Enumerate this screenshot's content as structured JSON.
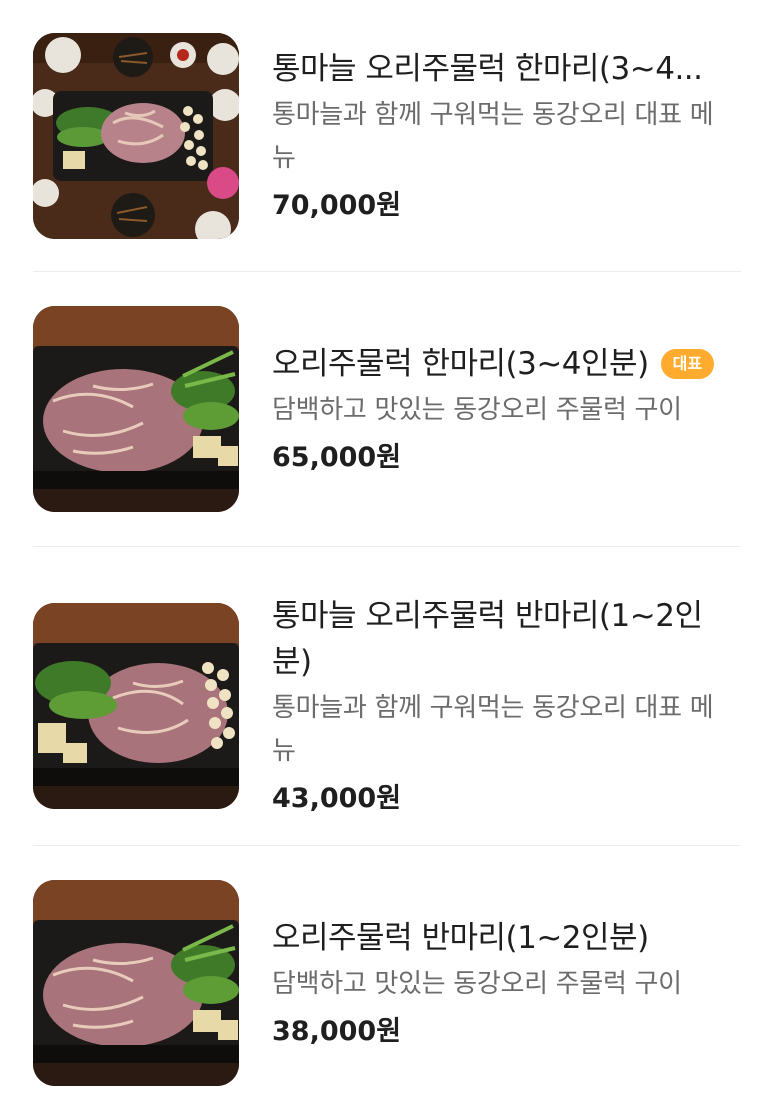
{
  "items": [
    {
      "title": "통마늘 오리주물럭 한마리(3~4...",
      "description": "통마늘과 함께 구워먹는 동강오리 대표 메뉴",
      "price": "70,000원",
      "badge": "",
      "image": "table-spread-photo"
    },
    {
      "title": "오리주물럭 한마리(3~4인분)",
      "description": "담백하고 맛있는 동강오리 주물럭 구이",
      "price": "65,000원",
      "badge": "대표",
      "image": "grill-plate-photo"
    },
    {
      "title": "통마늘 오리주물럭 반마리(1~2인분)",
      "description": "통마늘과 함께 구워먹는 동강오리 대표 메뉴",
      "price": "43,000원",
      "badge": "",
      "image": "garlic-grill-photo"
    },
    {
      "title": "오리주물럭 반마리(1~2인분)",
      "description": "담백하고 맛있는 동강오리 주물럭 구이",
      "price": "38,000원",
      "badge": "",
      "image": "grill-plate-photo"
    }
  ],
  "colors": {
    "badge": "#ffab2e",
    "text": "#1f1f1f",
    "muted": "#6c6c6c",
    "divider": "#ececec"
  }
}
